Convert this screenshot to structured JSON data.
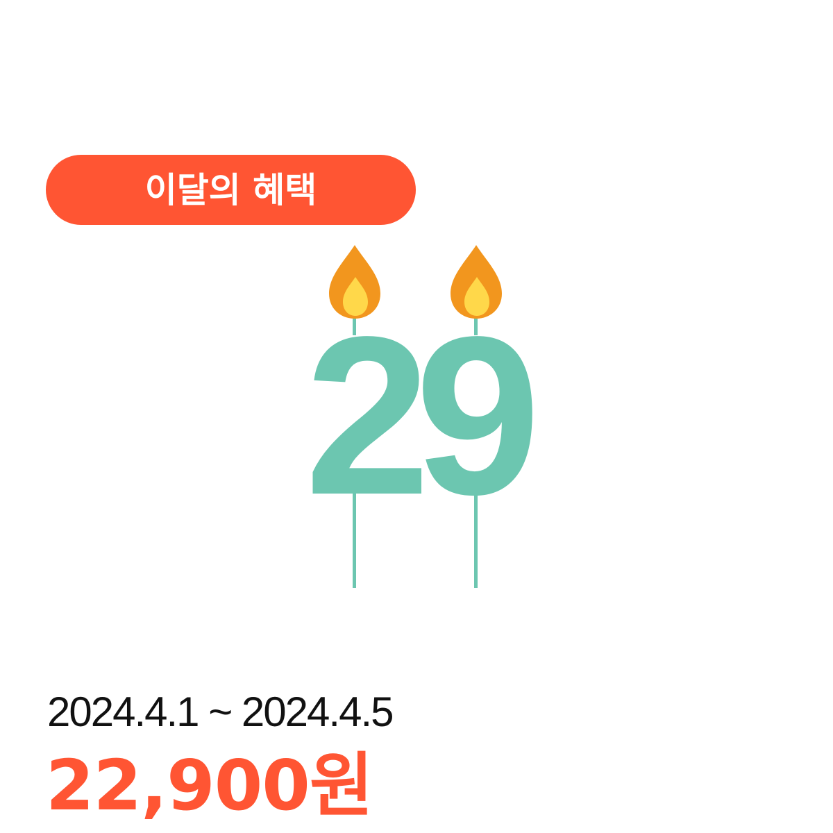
{
  "badge": {
    "label": "이달의 혜택",
    "color": "#ff5533"
  },
  "candle": {
    "number": "29",
    "number_color": "#6cc6b0",
    "flame_outer_color": "#f2961e",
    "flame_inner_color": "#ffd84a",
    "icons": [
      "candle-flame-icon",
      "candle-flame-icon"
    ]
  },
  "promo": {
    "period": "2024.4.1 ~ 2024.4.5",
    "price": "22,900원",
    "price_color": "#ff5533"
  }
}
